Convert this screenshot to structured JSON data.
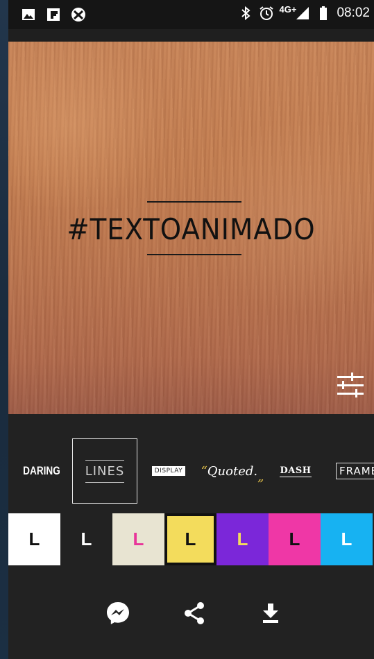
{
  "status_bar": {
    "time": "08:02",
    "network": "4G+",
    "left_icons": [
      "image-icon",
      "flipboard-icon",
      "xbox-icon"
    ],
    "right_icons": [
      "bluetooth-icon",
      "alarm-icon",
      "signal-icon",
      "battery-icon"
    ]
  },
  "preview": {
    "headline": "#TEXTOANIMADO",
    "adjust_icon": "sliders-icon"
  },
  "styles": [
    {
      "label": "DARING"
    },
    {
      "label": "LINES",
      "selected": true
    },
    {
      "label": "DISPLAY"
    },
    {
      "label": "Quoted.",
      "open_quote": "“",
      "close_quote": "„"
    },
    {
      "label": "DASH"
    },
    {
      "label": "FRAME"
    }
  ],
  "swatches": [
    {
      "letter": "L",
      "bg": "#ffffff",
      "fg": "#111111"
    },
    {
      "letter": "L",
      "bg": "#222222",
      "fg": "#ffffff"
    },
    {
      "letter": "L",
      "bg": "#e8e4d2",
      "fg": "#e8359a"
    },
    {
      "letter": "L",
      "bg": "#f3dc5c",
      "fg": "#111111",
      "selected": true
    },
    {
      "letter": "L",
      "bg": "#7b27d9",
      "fg": "#f3dc5c"
    },
    {
      "letter": "L",
      "bg": "#ef37a6",
      "fg": "#111111"
    },
    {
      "letter": "L",
      "bg": "#17b2f2",
      "fg": "#ffffff"
    }
  ],
  "actions": {
    "messenger_icon": "messenger-icon",
    "share_icon": "share-icon",
    "download_icon": "download-icon"
  },
  "colors": {
    "panel_bg": "#222222",
    "status_bg": "#151515",
    "headline": "#111111"
  }
}
